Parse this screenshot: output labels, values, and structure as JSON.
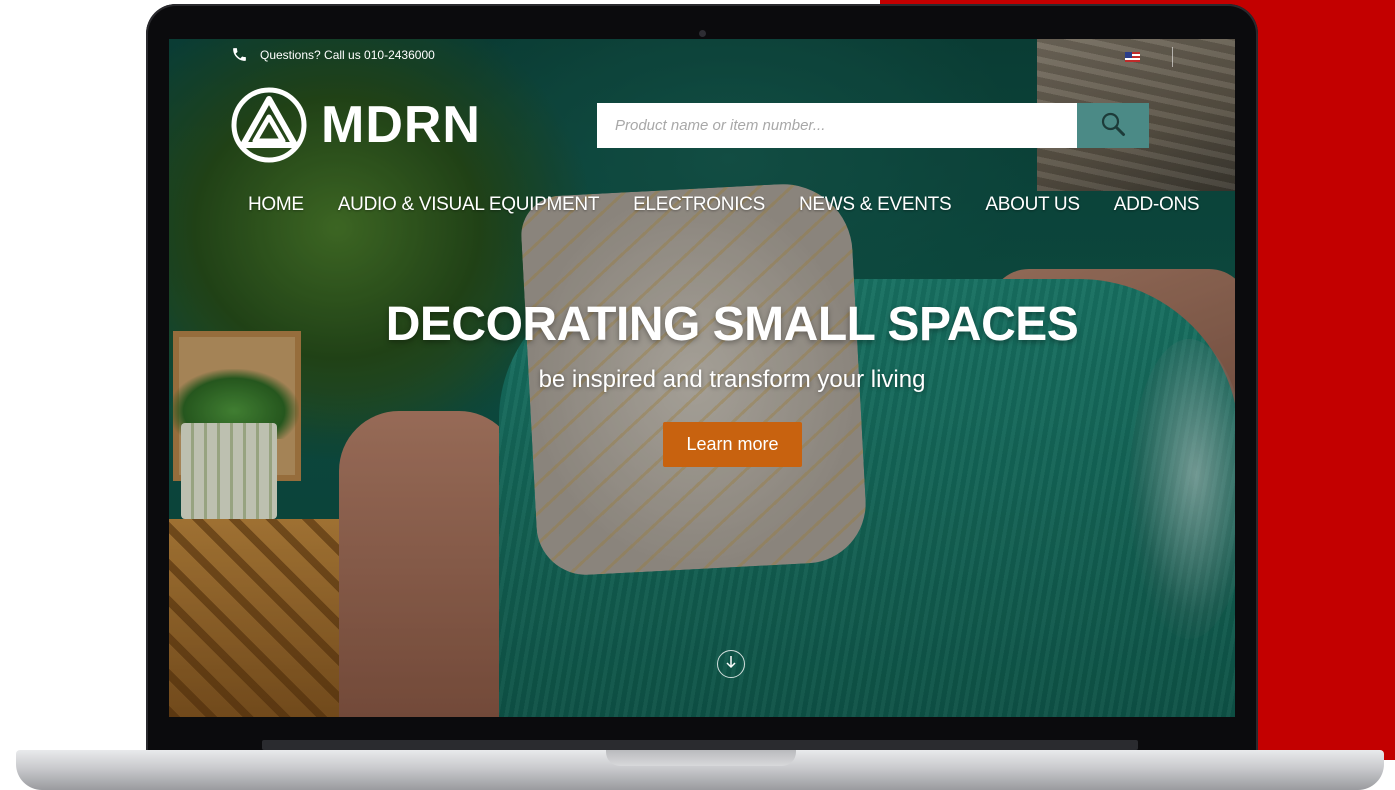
{
  "topbar": {
    "phone_text": "Questions? Call us 010-2436000",
    "phone_icon": "phone-icon",
    "flag_icon": "us-flag-icon"
  },
  "logo": {
    "text": "MDRN",
    "icon": "logo-mark-icon"
  },
  "search": {
    "placeholder": "Product name or item number...",
    "value": "",
    "button_icon": "search-icon",
    "button_color": "#4b8a86"
  },
  "nav": {
    "items": [
      {
        "label": "HOME"
      },
      {
        "label": "AUDIO & VISUAL EQUIPMENT"
      },
      {
        "label": "ELECTRONICS"
      },
      {
        "label": "NEWS & EVENTS"
      },
      {
        "label": "ABOUT US"
      },
      {
        "label": "ADD-ONS"
      }
    ]
  },
  "hero": {
    "title": "DECORATING SMALL SPACES",
    "subtitle": "be inspired and transform your living",
    "cta_label": "Learn more",
    "cta_color": "#c8620f",
    "scroll_icon": "arrow-down-circle-icon"
  },
  "colors": {
    "backdrop_red": "#c30000",
    "accent_teal": "#4b8a86"
  }
}
